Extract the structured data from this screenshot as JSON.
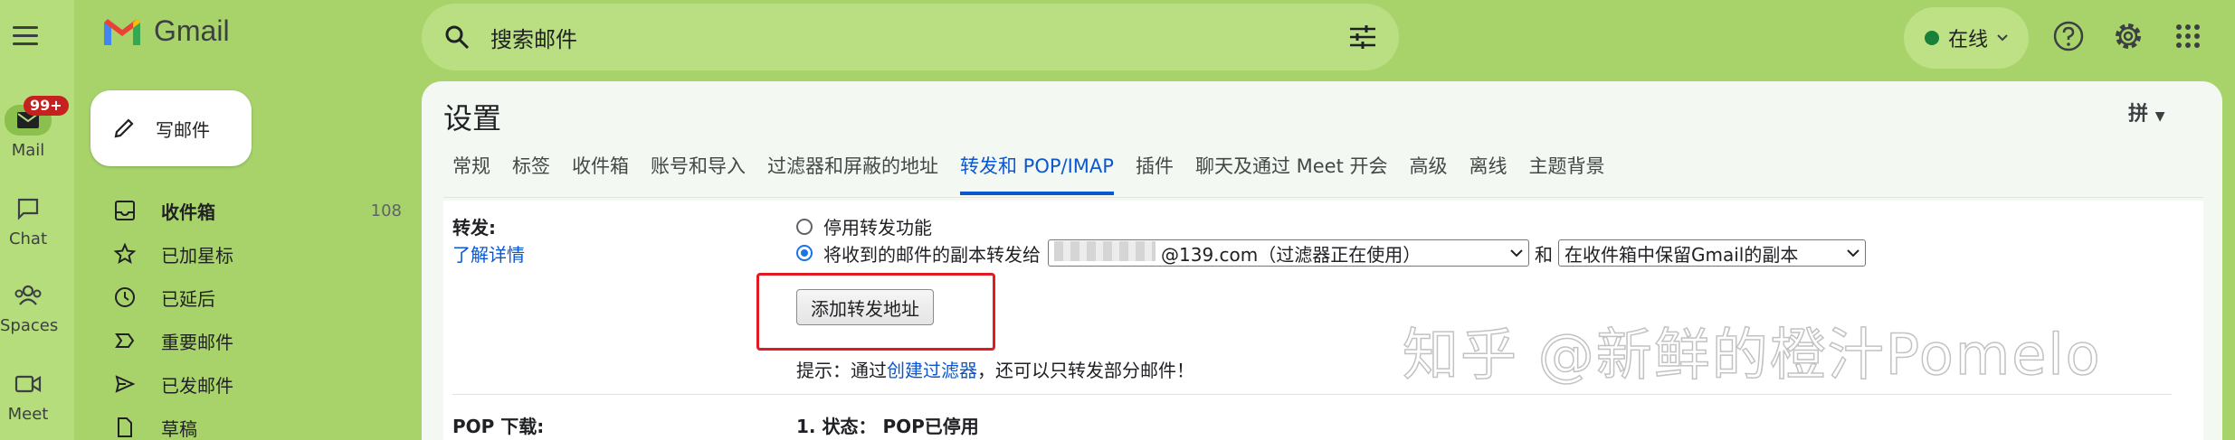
{
  "app": {
    "name": "Gmail"
  },
  "rail": {
    "items": [
      {
        "label": "Mail",
        "badge": "99+"
      },
      {
        "label": "Chat"
      },
      {
        "label": "Spaces"
      },
      {
        "label": "Meet"
      }
    ]
  },
  "search": {
    "placeholder": "搜索邮件"
  },
  "status": {
    "label": "在线"
  },
  "compose": {
    "label": "写邮件"
  },
  "nav": [
    {
      "label": "收件箱",
      "count": "108"
    },
    {
      "label": "已加星标"
    },
    {
      "label": "已延后"
    },
    {
      "label": "重要邮件"
    },
    {
      "label": "已发邮件"
    },
    {
      "label": "草稿"
    }
  ],
  "settings": {
    "title": "设置",
    "lang": "拼",
    "tabs": [
      "常规",
      "标签",
      "收件箱",
      "账号和导入",
      "过滤器和屏蔽的地址",
      "转发和 POP/IMAP",
      "插件",
      "聊天及通过 Meet 开会",
      "高级",
      "离线",
      "主题背景"
    ],
    "active_tab": "转发和 POP/IMAP"
  },
  "forwarding": {
    "heading": "转发:",
    "learn_more": "了解详情",
    "option_disable": "停用转发功能",
    "option_forward": "将收到的邮件的副本转发给",
    "address_select": "@139.com（过滤器正在使用）",
    "and": "和",
    "keep_select": "在收件箱中保留Gmail的副本",
    "add_button": "添加转发地址",
    "tip_prefix": "提示：通过",
    "tip_link": "创建过滤器",
    "tip_suffix": "，还可以只转发部分邮件！"
  },
  "pop": {
    "heading": "POP 下载:",
    "status": "1. 状态： POP已停用"
  },
  "watermark": "知乎 @新鲜的橙汁Pomelo",
  "colors": {
    "background": "#a8d36a",
    "accent": "#0b57d0",
    "highlight": "#e01b24"
  }
}
